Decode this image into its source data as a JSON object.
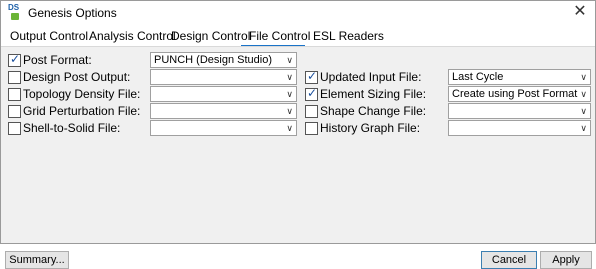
{
  "window": {
    "title": "Genesis Options",
    "app_icon_text": "DS",
    "close_glyph": "✕"
  },
  "tabs": [
    {
      "label": "Output Control"
    },
    {
      "label": "Analysis Control"
    },
    {
      "label": "Design Control"
    },
    {
      "label": "File Control"
    },
    {
      "label": "ESL Readers"
    }
  ],
  "active_tab": "File Control",
  "left_options": [
    {
      "label": "Post Format:",
      "checked": true,
      "value": "PUNCH (Design Studio)"
    },
    {
      "label": "Design Post Output:",
      "checked": false,
      "value": ""
    },
    {
      "label": "Topology Density File:",
      "checked": false,
      "value": ""
    },
    {
      "label": "Grid Perturbation File:",
      "checked": false,
      "value": ""
    },
    {
      "label": "Shell-to-Solid File:",
      "checked": false,
      "value": ""
    }
  ],
  "right_options": [
    {
      "label": "Updated Input File:",
      "checked": true,
      "value": "Last Cycle"
    },
    {
      "label": "Element Sizing File:",
      "checked": true,
      "value": "Create using Post Format"
    },
    {
      "label": "Shape Change File:",
      "checked": false,
      "value": ""
    },
    {
      "label": "History Graph File:",
      "checked": false,
      "value": ""
    }
  ],
  "buttons": {
    "summary": "Summary...",
    "cancel": "Cancel",
    "apply": "Apply"
  },
  "check_glyph": "✓",
  "chevron_glyph": "∨",
  "colors": {
    "accent": "#1a73c8",
    "pane": "#f0f0f0"
  }
}
